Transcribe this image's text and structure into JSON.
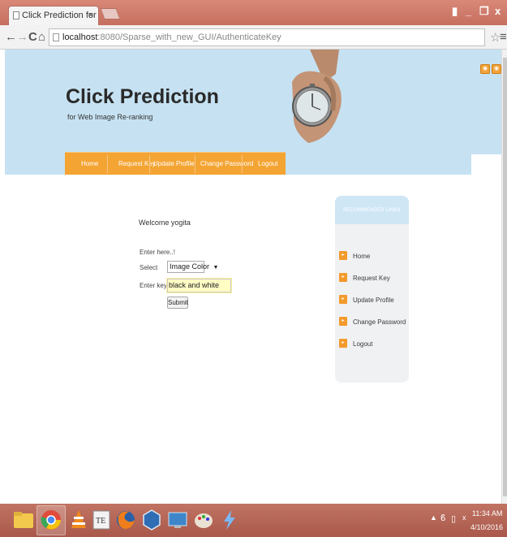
{
  "browser": {
    "tab_title": "Click Prediction for I",
    "tab_close": "×",
    "url_host": "localhost",
    "url_port_path": ":8080/Sparse_with_new_GUI/AuthenticateKey",
    "back": "←",
    "forward": "→",
    "reload": "C",
    "home": "⌂",
    "star": "☆",
    "menu": "≡",
    "win_minimize": "_",
    "win_restore": "❐",
    "win_close": "x",
    "win_user": "▮"
  },
  "site": {
    "title": "Click Prediction",
    "subtitle": "for Web Image Re-ranking"
  },
  "nav": {
    "items": [
      "Home",
      "Request Key",
      "Update Profile",
      "Change Password",
      "Logout"
    ]
  },
  "form": {
    "welcome": "Welcome yogita",
    "enter_here": "Enter here..!",
    "select_label": "Select",
    "select_value": "Image Color",
    "keyword_label": "Enter keyword",
    "keyword_value": "black and white",
    "submit_label": "Submit"
  },
  "sidebar": {
    "heading": "RECOMMENDED LINKS",
    "items": [
      "Home",
      "Request Key",
      "Update Profile",
      "Change Password",
      "Logout"
    ]
  },
  "taskbar": {
    "time": "11:34 AM",
    "date": "4/10/2016"
  },
  "colors": {
    "accent_orange": "#f4a433",
    "banner_blue": "#c6e2f2",
    "taskbar": "#b2604f"
  }
}
